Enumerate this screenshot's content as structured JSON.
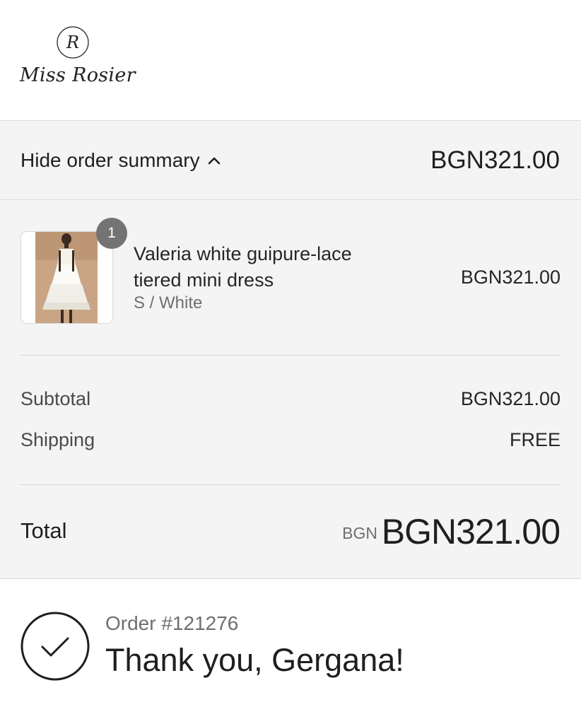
{
  "store": {
    "monogram": "R",
    "name": "Miss Rosier"
  },
  "summary_toggle": {
    "label": "Hide order summary",
    "icon": "chevron-up-icon",
    "price": "BGN321.00"
  },
  "line_items": [
    {
      "quantity": "1",
      "name": "Valeria white guipure-lace tiered mini dress",
      "variant": "S / White",
      "price": "BGN321.00"
    }
  ],
  "totals": {
    "subtotal_label": "Subtotal",
    "subtotal_value": "BGN321.00",
    "shipping_label": "Shipping",
    "shipping_value": "FREE",
    "total_label": "Total",
    "total_currency": "BGN",
    "total_value": "BGN321.00"
  },
  "confirmation": {
    "icon": "checkmark-circle-icon",
    "order_number": "Order #121276",
    "message": "Thank you, Gergana!"
  },
  "colors": {
    "summary_background": "#f4f4f4",
    "badge": "#737373",
    "text": "#1f1f1f",
    "muted_text": "#6f6f6f"
  }
}
